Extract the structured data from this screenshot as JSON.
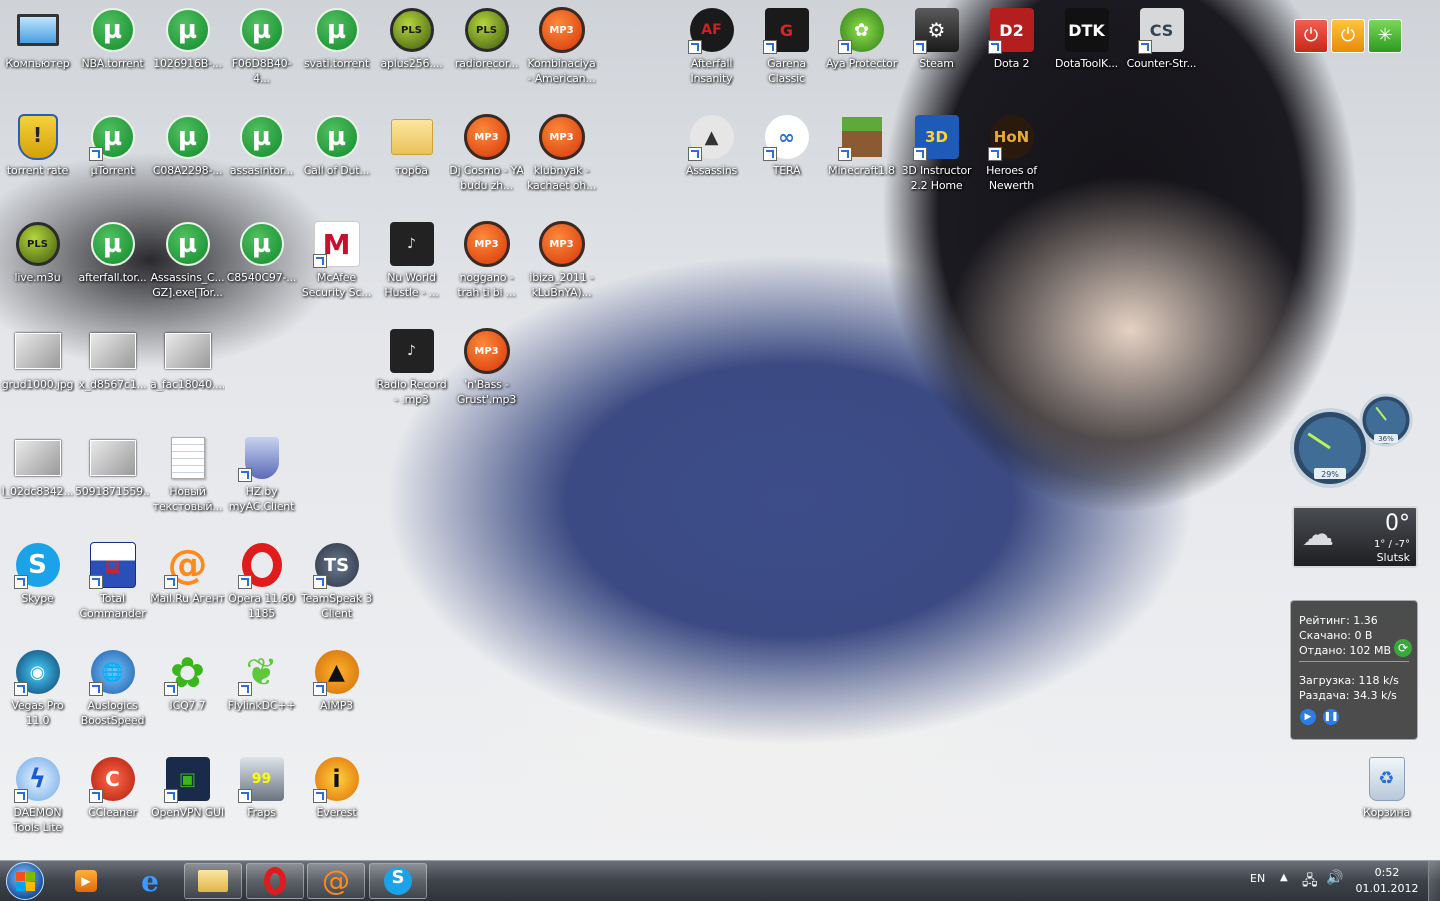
{
  "desktop_icons": [
    {
      "label": "Компьютер",
      "art": "computer"
    },
    {
      "label": "NBA.torrent",
      "art": "utorrent"
    },
    {
      "label": "1026916B-...",
      "art": "utorrent"
    },
    {
      "label": "F06D8B40-4...",
      "art": "utorrent"
    },
    {
      "label": "svati.torrent",
      "art": "utorrent"
    },
    {
      "label": "aplus256....",
      "art": "pls"
    },
    {
      "label": "radiorecor...",
      "art": "pls"
    },
    {
      "label": "Kombinaciya - American...",
      "art": "mp3"
    },
    {
      "label": "Afterfall Insanity",
      "art": "afterfall",
      "shortcut": true
    },
    {
      "label": "Garena Classic",
      "art": "garena",
      "shortcut": true
    },
    {
      "label": "Aya Protector",
      "art": "aya",
      "shortcut": true
    },
    {
      "label": "Steam",
      "art": "steam",
      "shortcut": true
    },
    {
      "label": "Dota 2",
      "art": "dota",
      "shortcut": true
    },
    {
      "label": "DotaToolK...",
      "art": "dtk"
    },
    {
      "label": "Counter-Str...",
      "art": "cs",
      "shortcut": true
    },
    {
      "label": "torrent rate",
      "art": "shield"
    },
    {
      "label": "µTorrent",
      "art": "utorrent",
      "shortcut": true
    },
    {
      "label": "C08A2298-...",
      "art": "utorrent"
    },
    {
      "label": "assasintor...",
      "art": "utorrent"
    },
    {
      "label": "Call of Dut...",
      "art": "utorrent"
    },
    {
      "label": "торба",
      "art": "folder"
    },
    {
      "label": "Dj Cosmo - YA budu zh...",
      "art": "mp3"
    },
    {
      "label": "klubnyak - kachaet oh...",
      "art": "mp3"
    },
    {
      "label": "Assassins",
      "art": "assassins",
      "shortcut": true
    },
    {
      "label": "TERA",
      "art": "tera",
      "shortcut": true
    },
    {
      "label": "Minecraft1.8",
      "art": "minecraft",
      "shortcut": true
    },
    {
      "label": "3D Instructor 2.2 Home",
      "art": "instructor",
      "shortcut": true
    },
    {
      "label": "Heroes of Newerth",
      "art": "hon",
      "shortcut": true
    },
    {
      "label": "live.m3u",
      "art": "pls"
    },
    {
      "label": "afterfall.tor...",
      "art": "utorrent"
    },
    {
      "label": "Assassins_C... GZ].exe[Tor...",
      "art": "utorrent"
    },
    {
      "label": "C8540C97-...",
      "art": "utorrent"
    },
    {
      "label": "McAfee Security Sc...",
      "art": "mcafee",
      "shortcut": true
    },
    {
      "label": "Nu World Hustle - ...",
      "art": "album"
    },
    {
      "label": "noggano - trah ti bi ...",
      "art": "mp3"
    },
    {
      "label": "ibiza_2011 - kLuBnYA)...",
      "art": "mp3"
    },
    {
      "label": "grud1000.jpg",
      "art": "photo"
    },
    {
      "label": "x_d8567c1...",
      "art": "photo"
    },
    {
      "label": "a_fac18040....",
      "art": "photo"
    },
    {
      "label": "Radio Record - .mp3",
      "art": "album"
    },
    {
      "label": "'n'Bass - Grust'.mp3",
      "art": "mp3"
    },
    {
      "label": "I_02dc8342...",
      "art": "photo"
    },
    {
      "label": "5091871559...",
      "art": "photo"
    },
    {
      "label": "Новый текстовый...",
      "art": "textfile"
    },
    {
      "label": "HZ.by myAC.Client",
      "art": "hzshield",
      "shortcut": true
    },
    {
      "label": "Skype",
      "art": "skype",
      "shortcut": true
    },
    {
      "label": "Total Commander",
      "art": "totalcmd",
      "shortcut": true
    },
    {
      "label": "Mail.Ru Агент",
      "art": "mailru",
      "shortcut": true
    },
    {
      "label": "Opera 11.60 1185",
      "art": "opera",
      "shortcut": true
    },
    {
      "label": "TeamSpeak 3 Client",
      "art": "teamspeak",
      "shortcut": true
    },
    {
      "label": "Vegas Pro 11.0",
      "art": "vegas",
      "shortcut": true
    },
    {
      "label": "Auslogics BoostSpeed",
      "art": "auslogics",
      "shortcut": true
    },
    {
      "label": "ICQ7.7",
      "art": "icq",
      "shortcut": true
    },
    {
      "label": "FlylinkDC++",
      "art": "flylink",
      "shortcut": true
    },
    {
      "label": "AIMP3",
      "art": "aimp",
      "shortcut": true
    },
    {
      "label": "DAEMON Tools Lite",
      "art": "daemon",
      "shortcut": true
    },
    {
      "label": "CCleaner",
      "art": "ccleaner",
      "shortcut": true
    },
    {
      "label": "OpenVPN GUI",
      "art": "openvpn",
      "shortcut": true
    },
    {
      "label": "Fraps",
      "art": "fraps",
      "shortcut": true
    },
    {
      "label": "Everest",
      "art": "everest",
      "shortcut": true
    },
    {
      "label": "Корзина",
      "art": "recycle"
    }
  ],
  "power_gadget": {
    "buttons": [
      "shutdown",
      "restart",
      "sleep"
    ]
  },
  "cpu_meter": {
    "cpu_percent": 29,
    "memory_percent": 36,
    "cpu_label": "29%",
    "mem_label": "36%"
  },
  "weather": {
    "temp": "0°",
    "range": "1° / -7°",
    "city": "Slutsk"
  },
  "torrent_gadget": {
    "rating_label": "Рейтинг:",
    "rating_value": "1.36",
    "downloaded_label": "Скачано:",
    "downloaded_value": "0 B",
    "uploaded_label": "Отдано:",
    "uploaded_value": "102 MB",
    "download_speed_label": "Загрузка:",
    "download_speed_value": "118 k/s",
    "upload_speed_label": "Раздача:",
    "upload_speed_value": "34.3 k/s"
  },
  "taskbar": {
    "pinned": [
      {
        "name": "windows-media-player",
        "open": false
      },
      {
        "name": "internet-explorer",
        "open": false
      },
      {
        "name": "explorer",
        "open": true
      },
      {
        "name": "opera",
        "open": true
      },
      {
        "name": "mail-ru-agent",
        "open": true
      },
      {
        "name": "skype",
        "open": true
      }
    ],
    "lang": "EN",
    "time": "0:52",
    "date": "01.01.2012"
  },
  "colors": {
    "utorrent": "#1a9a3a",
    "mp3": "#e2481a",
    "taskbar": "#3e434b"
  }
}
